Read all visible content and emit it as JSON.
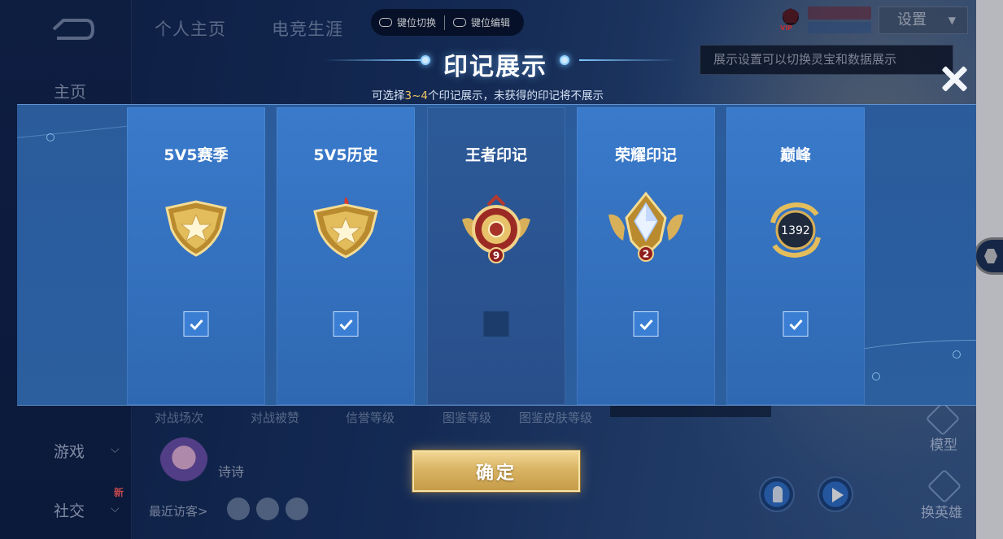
{
  "background": {
    "top_tabs": [
      "个人主页",
      "电竞生涯"
    ],
    "sidebar": {
      "home": "主页",
      "games": "游戏",
      "social": "社交",
      "new_badge": "新"
    },
    "keybinds": {
      "switch_label": "键位切换",
      "edit_label": "键位编辑"
    },
    "vip_label": "VIP",
    "settings_label": "设置",
    "settings_tip": "展示设置可以切换灵宝和数据展示",
    "stats": [
      "对战场次",
      "对战被赞",
      "信誉等级",
      "图鉴等级",
      "图鉴皮肤等级"
    ],
    "username": "诗诗",
    "recent_visitors": "最近访客>",
    "right_actions": {
      "model": "模型",
      "switch_hero": "换英雄"
    }
  },
  "modal": {
    "title": "印记展示",
    "subtitle_prefix": "可选择",
    "subtitle_range": "3~4",
    "subtitle_suffix": "个印记展示，未获得的印记将不展示",
    "confirm_label": "确定",
    "cards": [
      {
        "title": "5V5赛季",
        "badge": "star-shield-badge",
        "checked": true
      },
      {
        "title": "5V5历史",
        "badge": "flame-star-shield-badge",
        "checked": true
      },
      {
        "title": "王者印记",
        "badge": "king-mark-badge",
        "badge_number": "9",
        "checked": false
      },
      {
        "title": "荣耀印记",
        "badge": "glory-crystal-badge",
        "badge_number": "2",
        "checked": true
      },
      {
        "title": "巅峰",
        "badge": "peak-score-badge",
        "badge_number": "1392",
        "checked": true
      }
    ]
  },
  "colors": {
    "panel_blue": "#2c5f9d",
    "card_blue": "#3573c1",
    "checkbox_blue": "#3b7fd4",
    "highlight_gold": "#f3c765",
    "confirm_gold": "#d9b463"
  }
}
